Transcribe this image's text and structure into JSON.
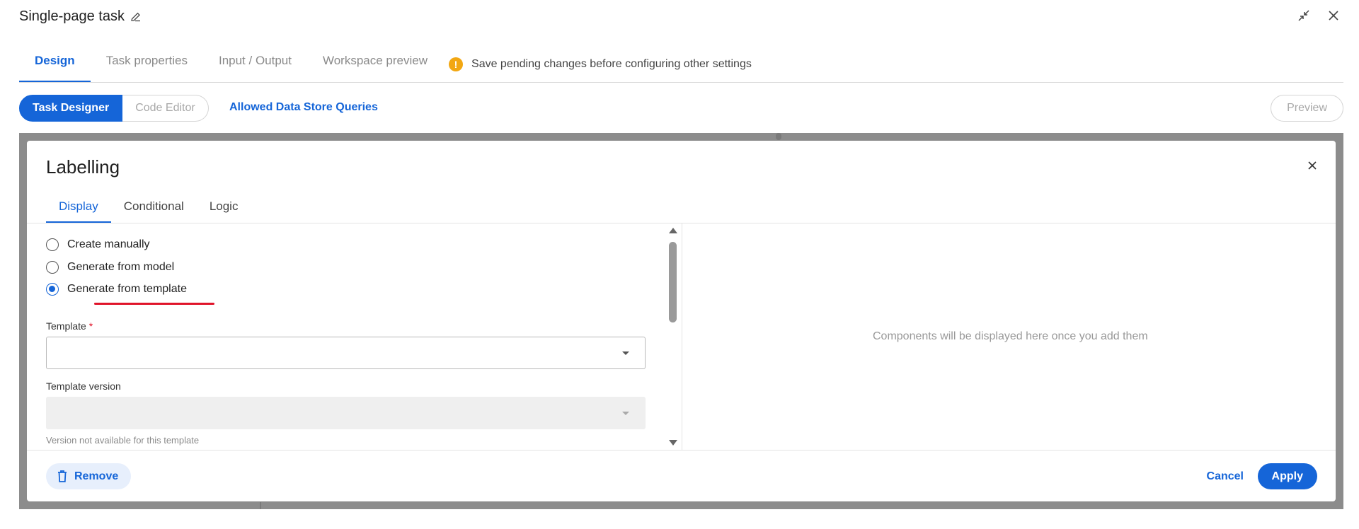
{
  "header": {
    "title": "Single-page task",
    "edit_icon": "pencil-icon",
    "collapse_icon": "collapse-icon",
    "close_icon": "close-icon"
  },
  "top_tabs": [
    {
      "label": "Design",
      "active": true
    },
    {
      "label": "Task properties",
      "active": false
    },
    {
      "label": "Input / Output",
      "active": false
    },
    {
      "label": "Workspace preview",
      "active": false
    }
  ],
  "warning": {
    "icon": "warning-icon",
    "text": "Save pending changes before configuring other settings",
    "color": "#f2a712"
  },
  "editor_toggle": {
    "task_designer": "Task Designer",
    "code_editor": "Code Editor"
  },
  "allowed_queries_link": "Allowed Data Store Queries",
  "preview_label": "Preview",
  "modal": {
    "title": "Labelling",
    "tabs": [
      {
        "label": "Display",
        "active": true
      },
      {
        "label": "Conditional",
        "active": false
      },
      {
        "label": "Logic",
        "active": false
      }
    ],
    "options": [
      {
        "label": "Create manually",
        "selected": false
      },
      {
        "label": "Generate from model",
        "selected": false
      },
      {
        "label": "Generate from template",
        "selected": true
      }
    ],
    "template_label": "Template",
    "required_mark": "*",
    "template_value": "",
    "template_version_label": "Template version",
    "template_version_value": "",
    "version_hint": "Version not available for this template",
    "empty_message": "Components will be displayed here once you add them",
    "remove_label": "Remove",
    "cancel_label": "Cancel",
    "apply_label": "Apply"
  },
  "colors": {
    "accent": "#1565d8",
    "required": "#e0142a",
    "backdrop": "#8c8c8c"
  }
}
